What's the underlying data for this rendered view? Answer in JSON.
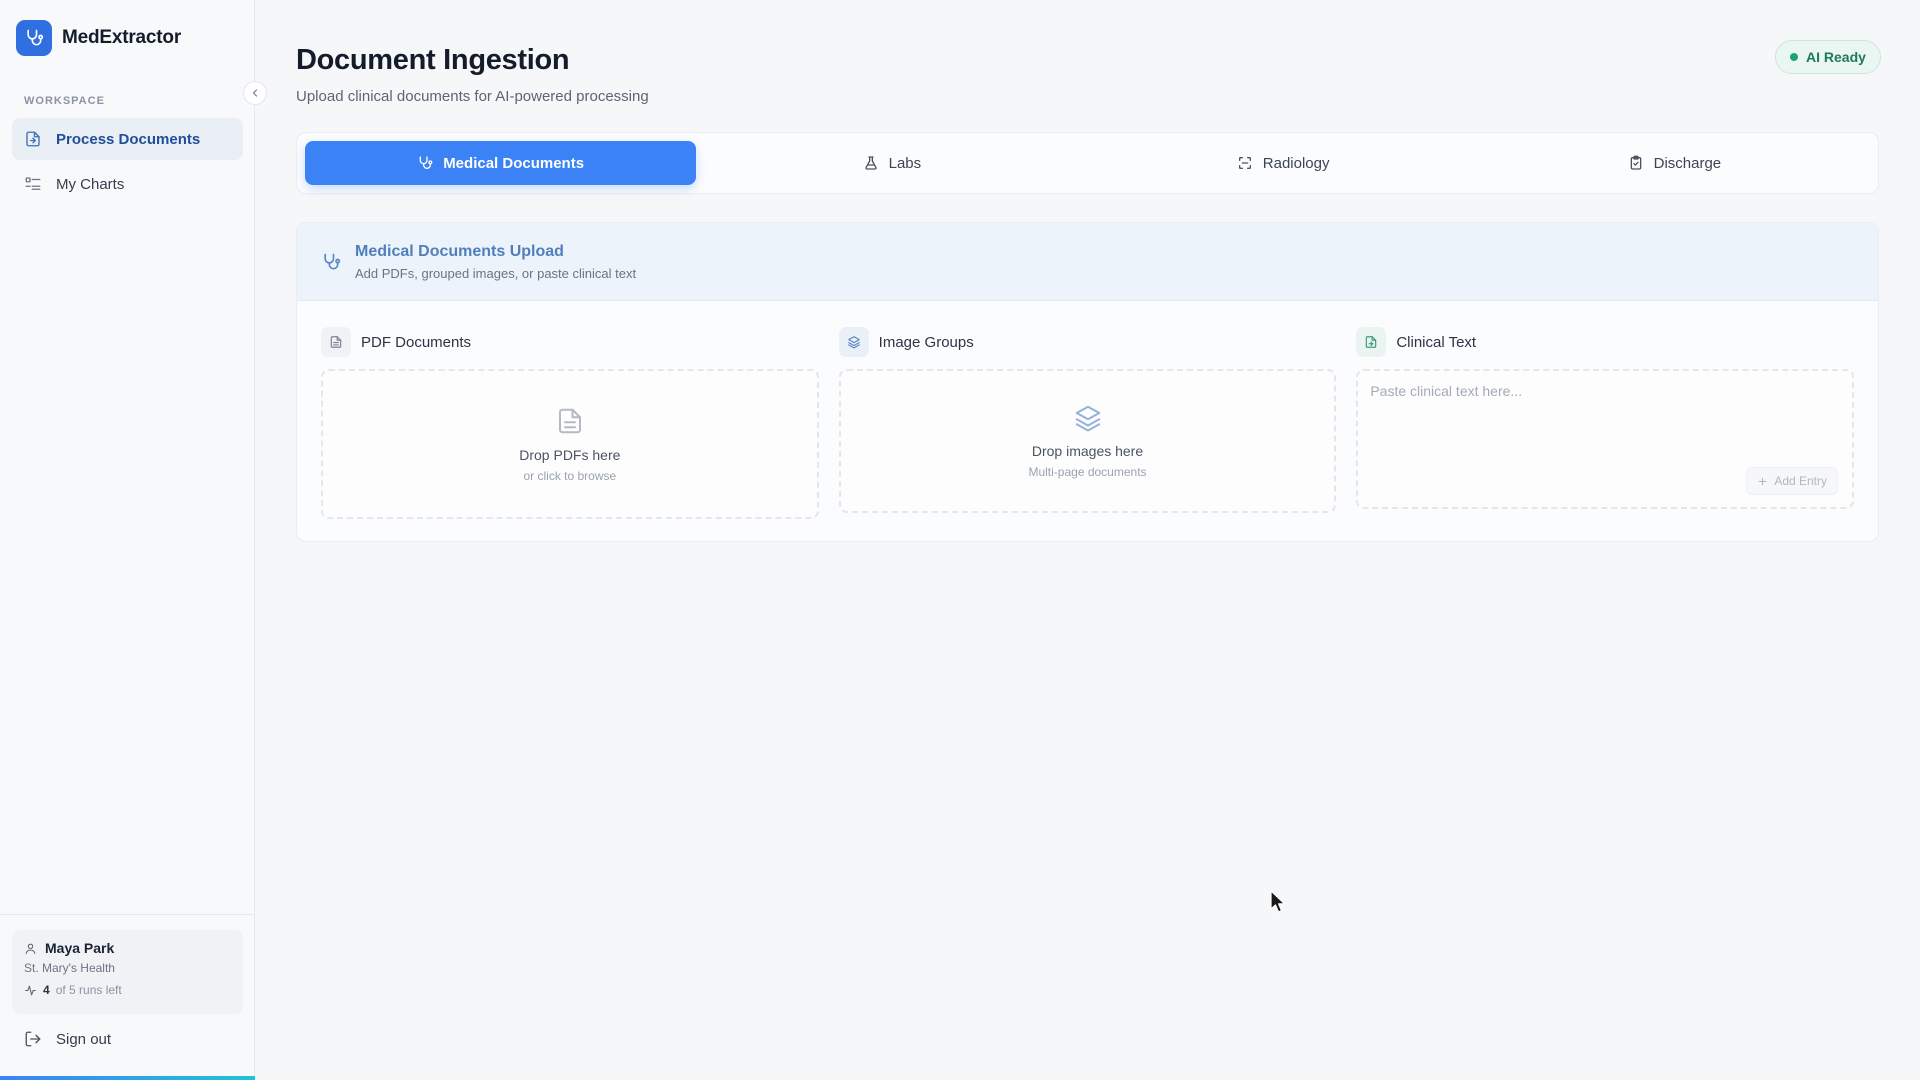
{
  "app": {
    "name": "MedExtractor"
  },
  "sidebar": {
    "section_label": "WORKSPACE",
    "items": [
      {
        "label": "Process Documents",
        "icon": "file-arrow-icon",
        "active": true
      },
      {
        "label": "My Charts",
        "icon": "list-icon",
        "active": false
      }
    ],
    "user": {
      "name": "Maya Park",
      "org": "St. Mary's Health",
      "runs_count": "4",
      "runs_text": "of 5 runs left"
    },
    "sign_out_label": "Sign out"
  },
  "header": {
    "title": "Document Ingestion",
    "subtitle": "Upload clinical documents for AI-powered processing",
    "status": "AI Ready"
  },
  "tabs": [
    {
      "label": "Medical Documents",
      "icon": "stethoscope-icon",
      "active": true
    },
    {
      "label": "Labs",
      "icon": "flask-icon",
      "active": false
    },
    {
      "label": "Radiology",
      "icon": "scan-icon",
      "active": false
    },
    {
      "label": "Discharge",
      "icon": "clipboard-icon",
      "active": false
    }
  ],
  "upload": {
    "title": "Medical Documents Upload",
    "subtitle": "Add PDFs, grouped images, or paste clinical text",
    "pdf": {
      "label": "PDF Documents",
      "drop_main": "Drop PDFs here",
      "drop_sub": "or click to browse"
    },
    "images": {
      "label": "Image Groups",
      "drop_main": "Drop images here",
      "drop_sub": "Multi-page documents"
    },
    "text": {
      "label": "Clinical Text",
      "placeholder": "Paste clinical text here...",
      "add_label": "Add Entry"
    }
  },
  "colors": {
    "accent": "#3b82f6",
    "brand": "#2f6fe0",
    "status": "#1ea27a"
  }
}
